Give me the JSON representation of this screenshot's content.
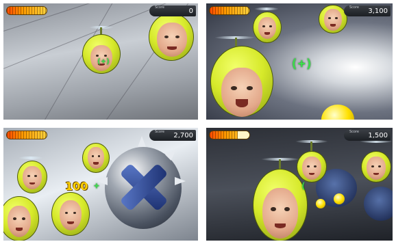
{
  "panels": [
    {
      "id": "top-left",
      "score_label": "Score",
      "score": "0",
      "health_fraction": 1.0
    },
    {
      "id": "top-right",
      "score_label": "Score",
      "score": "3,100",
      "health_fraction": 1.0
    },
    {
      "id": "bottom-left",
      "score_label": "Score",
      "score": "2,700",
      "health_fraction": 1.0,
      "floating_points": "100"
    },
    {
      "id": "bottom-right",
      "score_label": "Score",
      "score": "1,500",
      "health_fraction": 0.7
    }
  ],
  "reticle_symbol": "(+)",
  "colors": {
    "helmet": "#d6e92a",
    "reticle": "#3be04a",
    "health_bar": "#ff9a00",
    "score_bg": "#1c1f24"
  }
}
